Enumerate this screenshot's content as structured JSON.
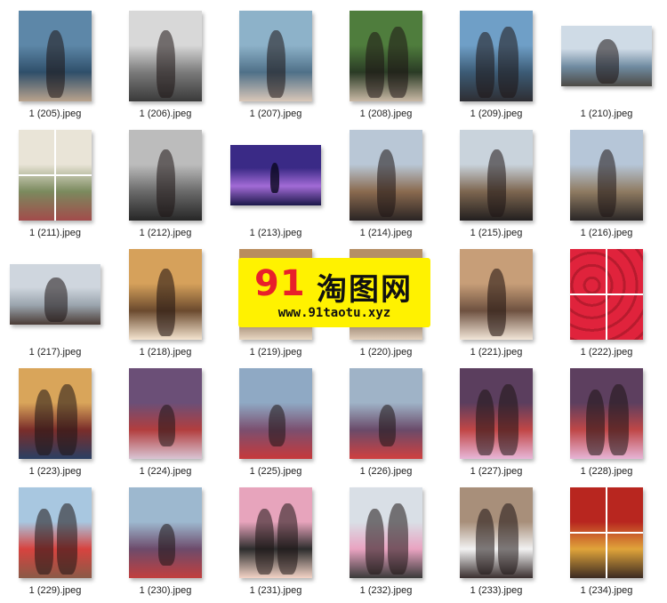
{
  "files": [
    {
      "name": "1 (205).jpeg",
      "orient": "portrait",
      "colors": [
        "#5d87a8",
        "#2f4f6a",
        "#b9a38d"
      ],
      "style": "woman"
    },
    {
      "name": "1 (206).jpeg",
      "orient": "portrait",
      "colors": [
        "#d8d8d8",
        "#7a7a7a",
        "#3a3a3a"
      ],
      "style": "woman"
    },
    {
      "name": "1 (207).jpeg",
      "orient": "portrait",
      "colors": [
        "#8db2c9",
        "#4f7088",
        "#d9c7b8"
      ],
      "style": "woman"
    },
    {
      "name": "1 (208).jpeg",
      "orient": "portrait",
      "colors": [
        "#4f7d3d",
        "#2a3b25",
        "#c9b9a6"
      ],
      "style": "couple"
    },
    {
      "name": "1 (209).jpeg",
      "orient": "portrait",
      "colors": [
        "#6f9fc7",
        "#3c5b75",
        "#2e2e33"
      ],
      "style": "couple"
    },
    {
      "name": "1 (210).jpeg",
      "orient": "landscape",
      "colors": [
        "#cfdbe6",
        "#6f8aa0",
        "#4d4a45"
      ],
      "style": "man"
    },
    {
      "name": "1 (211).jpeg",
      "orient": "portrait",
      "colors": [
        "#e9e4d7",
        "#7b8a5e",
        "#a24b4b"
      ],
      "style": "collage"
    },
    {
      "name": "1 (212).jpeg",
      "orient": "portrait",
      "colors": [
        "#bcbcbc",
        "#6a6a6a",
        "#262626"
      ],
      "style": "woman"
    },
    {
      "name": "1 (213).jpeg",
      "orient": "landscape",
      "colors": [
        "#3a2a86",
        "#a26bd6",
        "#1b1749"
      ],
      "style": "night"
    },
    {
      "name": "1 (214).jpeg",
      "orient": "portrait",
      "colors": [
        "#b9c7d6",
        "#8a6a4f",
        "#2a2424"
      ],
      "style": "woman"
    },
    {
      "name": "1 (215).jpeg",
      "orient": "portrait",
      "colors": [
        "#c9d3dc",
        "#7d6650",
        "#221f1f"
      ],
      "style": "woman"
    },
    {
      "name": "1 (216).jpeg",
      "orient": "portrait",
      "colors": [
        "#b6c6d8",
        "#8f7b62",
        "#2a2626"
      ],
      "style": "woman"
    },
    {
      "name": "1 (217).jpeg",
      "orient": "landscape",
      "colors": [
        "#cfd6de",
        "#9aa4ad",
        "#4a3b35"
      ],
      "style": "woman"
    },
    {
      "name": "1 (218).jpeg",
      "orient": "portrait",
      "colors": [
        "#d6a15b",
        "#6b4a2e",
        "#f4e4cf"
      ],
      "style": "man"
    },
    {
      "name": "1 (219).jpeg",
      "orient": "portrait",
      "colors": [
        "#b98d5e",
        "#6a4c33",
        "#e9d8c3"
      ],
      "style": "plain"
    },
    {
      "name": "1 (220).jpeg",
      "orient": "portrait",
      "colors": [
        "#b58f66",
        "#5c4330",
        "#e3d1bd"
      ],
      "style": "plain"
    },
    {
      "name": "1 (221).jpeg",
      "orient": "portrait",
      "colors": [
        "#c79e78",
        "#6e5140",
        "#f2e6d8"
      ],
      "style": "man"
    },
    {
      "name": "1 (222).jpeg",
      "orient": "portrait",
      "colors": [
        "#e0233c",
        "#8fd3cf",
        "#f7eef0"
      ],
      "style": "grid4"
    },
    {
      "name": "1 (223).jpeg",
      "orient": "portrait",
      "colors": [
        "#d9a55a",
        "#7a2d2a",
        "#2a3f63"
      ],
      "style": "couple"
    },
    {
      "name": "1 (224).jpeg",
      "orient": "portrait",
      "colors": [
        "#6b4f77",
        "#b23e3e",
        "#d9c5d4"
      ],
      "style": "pool"
    },
    {
      "name": "1 (225).jpeg",
      "orient": "portrait",
      "colors": [
        "#8fa9c4",
        "#7b4f6f",
        "#c7393b"
      ],
      "style": "pool"
    },
    {
      "name": "1 (226).jpeg",
      "orient": "portrait",
      "colors": [
        "#9fb3c7",
        "#6a4b6a",
        "#d0403f"
      ],
      "style": "pool"
    },
    {
      "name": "1 (227).jpeg",
      "orient": "portrait",
      "colors": [
        "#5b3e5e",
        "#c14646",
        "#e7b7d8"
      ],
      "style": "couple"
    },
    {
      "name": "1 (228).jpeg",
      "orient": "portrait",
      "colors": [
        "#5d3f5f",
        "#bf4747",
        "#e6b5d6"
      ],
      "style": "couple"
    },
    {
      "name": "1 (229).jpeg",
      "orient": "portrait",
      "colors": [
        "#a8c7e0",
        "#d7433f",
        "#8a5a47"
      ],
      "style": "couple"
    },
    {
      "name": "1 (230).jpeg",
      "orient": "portrait",
      "colors": [
        "#9db8cf",
        "#6d4b6b",
        "#c23f3e"
      ],
      "style": "pool"
    },
    {
      "name": "1 (231).jpeg",
      "orient": "portrait",
      "colors": [
        "#e7a4bc",
        "#2d2d2d",
        "#f3d3c6"
      ],
      "style": "couple"
    },
    {
      "name": "1 (232).jpeg",
      "orient": "portrait",
      "colors": [
        "#d9dfe6",
        "#e9a3c1",
        "#3a3a3a"
      ],
      "style": "couple"
    },
    {
      "name": "1 (233).jpeg",
      "orient": "portrait",
      "colors": [
        "#a88f7a",
        "#f2f2f2",
        "#3a2f2f"
      ],
      "style": "couple"
    },
    {
      "name": "1 (234).jpeg",
      "orient": "portrait",
      "colors": [
        "#b8261f",
        "#e0a43a",
        "#3b2a22"
      ],
      "style": "collage"
    }
  ],
  "watermark": {
    "number": "91",
    "chinese": "淘图网",
    "url": "www.91taotu.xyz",
    "colors": {
      "background": "#fff200",
      "number": "#e8202a",
      "text": "#111111"
    }
  }
}
